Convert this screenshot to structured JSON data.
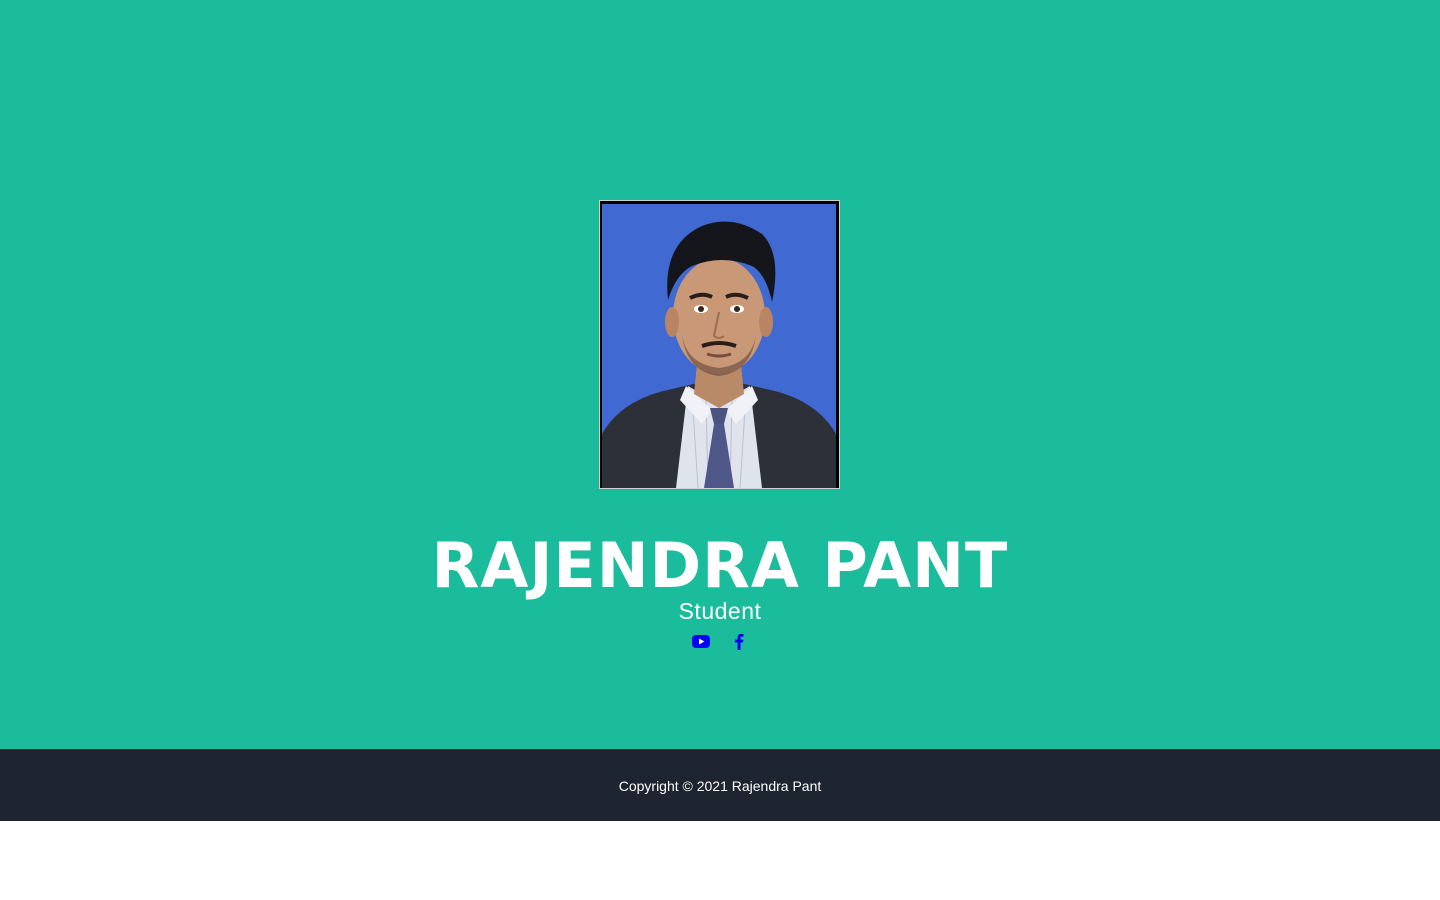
{
  "profile": {
    "name": "RAJENDRA PANT",
    "role": "Student",
    "photo_alt": "Rajendra Pant"
  },
  "social": [
    {
      "name": "youtube",
      "icon": "youtube-icon"
    },
    {
      "name": "facebook",
      "icon": "facebook-icon"
    }
  ],
  "footer": {
    "copyright": "Copyright © 2021 Rajendra Pant"
  },
  "colors": {
    "hero_bg": "#1abc9c",
    "footer_bg": "#1e2530",
    "social_icon": "#0000ff",
    "photo_bg": "#4169d2"
  }
}
